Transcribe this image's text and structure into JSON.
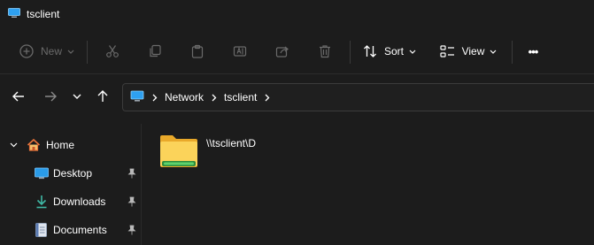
{
  "window": {
    "title": "tsclient"
  },
  "toolbar": {
    "new_label": "New",
    "sort_label": "Sort",
    "view_label": "View",
    "more_label": "•••"
  },
  "address": {
    "segments": [
      "Network",
      "tsclient"
    ]
  },
  "sidebar": {
    "items": [
      {
        "label": "Home",
        "icon": "home-icon",
        "pinned": false
      },
      {
        "label": "Desktop",
        "icon": "desktop-icon",
        "pinned": true
      },
      {
        "label": "Downloads",
        "icon": "download-icon",
        "pinned": true
      },
      {
        "label": "Documents",
        "icon": "documents-icon",
        "pinned": true
      }
    ]
  },
  "content": {
    "items": [
      {
        "label": "\\\\tsclient\\D",
        "icon": "network-drive-folder-icon"
      }
    ]
  },
  "colors": {
    "background": "#1c1c1c",
    "disabled": "#6a6a6a",
    "folder": "#f0c046",
    "drive_bar": "#4caf50",
    "accent": "#4cc2ff"
  }
}
